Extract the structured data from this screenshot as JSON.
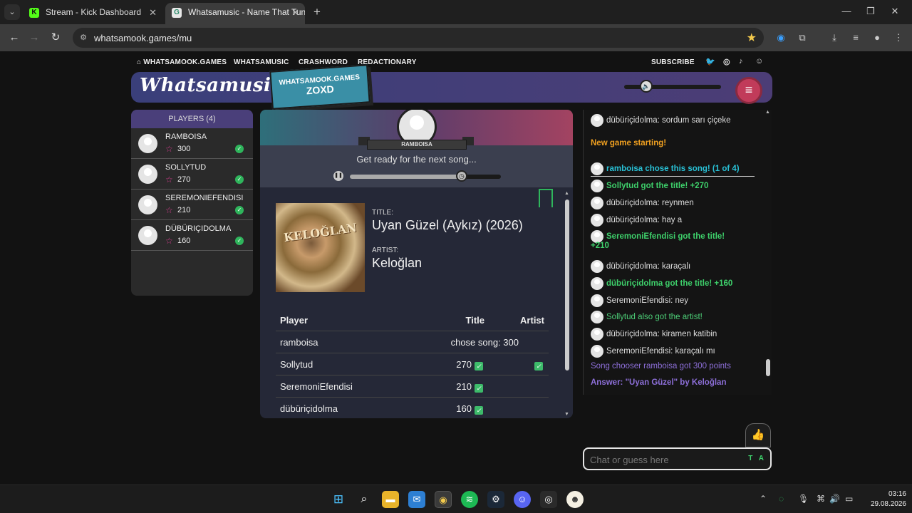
{
  "browser": {
    "tabs": [
      {
        "title": "Stream - Kick Dashboard",
        "favicon": "K",
        "active": false
      },
      {
        "title": "Whatsamusic - Name That Tune",
        "favicon": "G",
        "active": true
      }
    ],
    "url": "whatsamook.games/mu"
  },
  "sitenav": {
    "home": "WHATSAMOOK.GAMES",
    "items": [
      "WHATSAMUSIC",
      "CRASHWORD",
      "REDACTIONARY"
    ],
    "subscribe": "SUBSCRIBE",
    "social_icons": [
      "twitter-icon",
      "instagram-icon",
      "tiktok-icon",
      "discord-icon"
    ]
  },
  "banner": {
    "logo": "Whatsamusic",
    "badge_site": "WHATSAMOOK.GAMES",
    "badge_code": "ZOXD",
    "volume_level": 0.2
  },
  "players": {
    "header": "PLAYERS (4)",
    "list": [
      {
        "name": "RAMBOISA",
        "score": "300"
      },
      {
        "name": "SOLLYTUD",
        "score": "270"
      },
      {
        "name": "SEREMONIEFENDISI",
        "score": "210"
      },
      {
        "name": "DÜBÜRIÇIDOLMA",
        "score": "160"
      }
    ]
  },
  "game": {
    "chooser": "RAMBOISA",
    "status": "Get ready for the next song...",
    "progress": 0.74,
    "title_label": "TITLE:",
    "title": "Uyan Güzel (Aykız) (2026)",
    "artist_label": "ARTIST:",
    "artist": "Keloğlan",
    "album_text": "KELOĞLAN",
    "table": {
      "headers": {
        "player": "Player",
        "title": "Title",
        "artist": "Artist"
      },
      "rows": [
        {
          "player": "ramboisa",
          "title": "chose song: 300",
          "title_check": false,
          "artist_check": false
        },
        {
          "player": "Sollytud",
          "title": "270",
          "title_check": true,
          "artist_check": true
        },
        {
          "player": "SeremoniEfendisi",
          "title": "210",
          "title_check": true,
          "artist_check": false
        },
        {
          "player": "dübüriçidolma",
          "title": "160",
          "title_check": true,
          "artist_check": false
        }
      ]
    }
  },
  "chat": {
    "messages": [
      {
        "text": "dübüriçidolma: sordum sarı çiçeke",
        "avatar": true,
        "style": ""
      },
      {
        "text": "New game starting!",
        "avatar": false,
        "style": "orange"
      },
      {
        "text": "ramboisa chose this song! (1 of 4)",
        "avatar": true,
        "style": "cyan"
      },
      {
        "text": "Sollytud got the title! +270",
        "avatar": true,
        "style": "green"
      },
      {
        "text": "dübüriçidolma: reynmen",
        "avatar": true,
        "style": ""
      },
      {
        "text": "dübüriçidolma: hay a",
        "avatar": true,
        "style": ""
      },
      {
        "text": "SeremoniEfendisi got the title!",
        "avatar": true,
        "style": "green"
      },
      {
        "text": "+210",
        "avatar": false,
        "style": "green"
      },
      {
        "text": "dübüriçidolma: karaçalı",
        "avatar": true,
        "style": ""
      },
      {
        "text": "dübüriçidolma got the title! +160",
        "avatar": true,
        "style": "green"
      },
      {
        "text": "SeremoniEfendisi: ney",
        "avatar": true,
        "style": ""
      },
      {
        "text": "Sollytud also got the artist!",
        "avatar": true,
        "style": "lgreen"
      },
      {
        "text": "dübüriçidolma: kiramen katibin",
        "avatar": true,
        "style": ""
      },
      {
        "text": "SeremoniEfendisi: karaçalı mı",
        "avatar": true,
        "style": ""
      },
      {
        "text": "Song chooser ramboisa got 300 points",
        "avatar": false,
        "style": "purple"
      },
      {
        "text": "Answer: \"Uyan Güzel\" by Keloğlan",
        "avatar": false,
        "style": "purple-b"
      }
    ],
    "input_placeholder": "Chat or guess here",
    "input_tags": "T A"
  },
  "taskbar": {
    "time": "03:16",
    "date": "29.08.2026"
  }
}
